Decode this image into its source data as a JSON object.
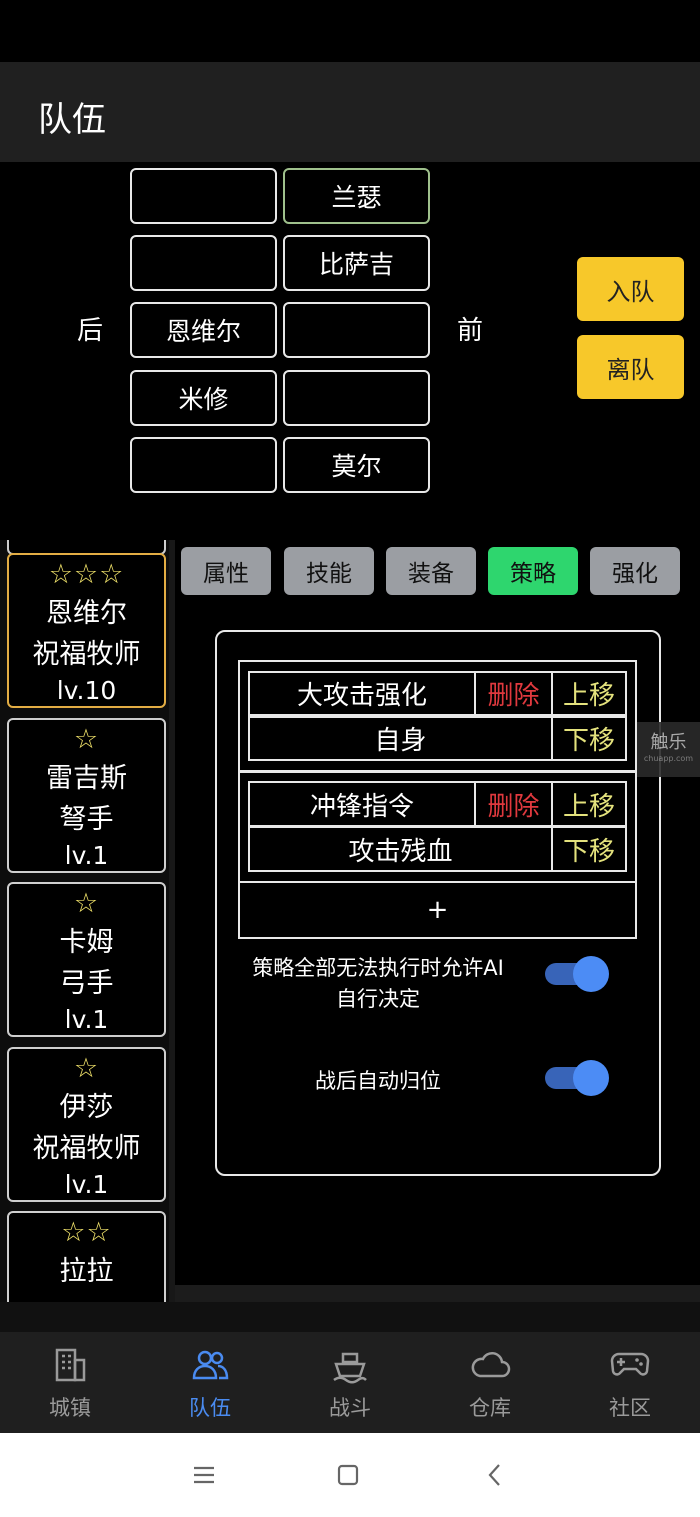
{
  "header": {
    "title": "队伍"
  },
  "formation": {
    "back_label": "后",
    "front_label": "前",
    "back_slots": [
      "",
      "",
      "恩维尔",
      "米修",
      ""
    ],
    "front_slots": [
      "兰瑟",
      "比萨吉",
      "",
      "",
      "莫尔"
    ],
    "buttons": {
      "join": "入队",
      "leave": "离队"
    }
  },
  "roster": [
    {
      "stars": "☆☆☆",
      "name": "恩维尔",
      "class": "祝福牧师",
      "level": "lv.10",
      "selected": true
    },
    {
      "stars": "☆",
      "name": "雷吉斯",
      "class": "弩手",
      "level": "lv.1"
    },
    {
      "stars": "☆",
      "name": "卡姆",
      "class": "弓手",
      "level": "lv.1"
    },
    {
      "stars": "☆",
      "name": "伊莎",
      "class": "祝福牧师",
      "level": "lv.1"
    },
    {
      "stars": "☆☆",
      "name": "拉拉",
      "class": "",
      "level": ""
    }
  ],
  "tabs": [
    "属性",
    "技能",
    "装备",
    "策略",
    "强化"
  ],
  "active_tab": "策略",
  "strategy": {
    "rules": [
      {
        "action": "大攻击强化",
        "condition": "自身"
      },
      {
        "action": "冲锋指令",
        "condition": "攻击残血"
      }
    ],
    "delete_label": "删除",
    "up_label": "上移",
    "down_label": "下移",
    "add_label": "+",
    "option_ai": "策略全部无法执行时允许AI自行决定",
    "option_ai_line1": "策略全部无法执行时允许AI",
    "option_ai_line2": "自行决定",
    "option_ai_on": true,
    "option_return": "战后自动归位",
    "option_return_on": true
  },
  "watermark": {
    "line1": "触乐",
    "line2": "chuapp.com"
  },
  "bottom_tabs": [
    "城镇",
    "队伍",
    "战斗",
    "仓库",
    "社区"
  ],
  "active_bottom_tab": "队伍",
  "colors": {
    "accent": "#4a8bf0",
    "active_tab": "#2ed66e",
    "action_button": "#f7c82a",
    "delete": "#e0393e",
    "move": "#e4e27d",
    "star": "#f0e26a"
  }
}
